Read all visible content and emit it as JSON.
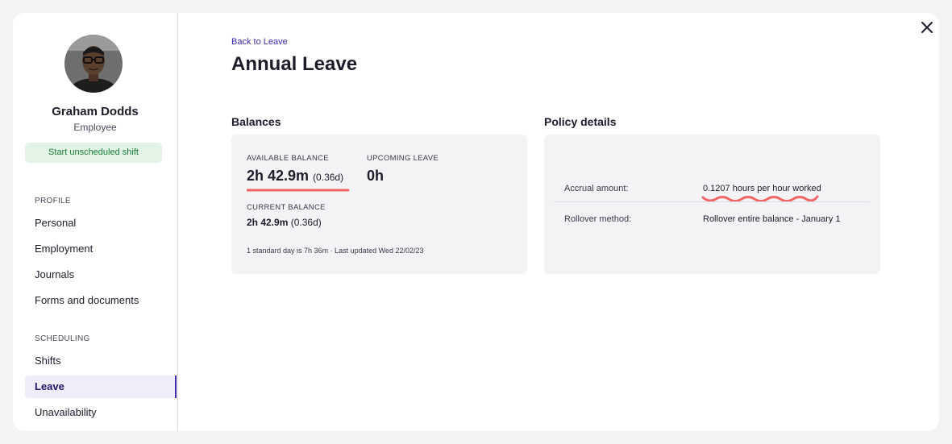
{
  "employee": {
    "name": "Graham Dodds",
    "role": "Employee"
  },
  "sidebar": {
    "shift_button": "Start unscheduled shift",
    "profile_label": "PROFILE",
    "profile_items": [
      "Personal",
      "Employment",
      "Journals",
      "Forms and documents"
    ],
    "scheduling_label": "SCHEDULING",
    "scheduling_items": [
      "Shifts",
      "Leave",
      "Unavailability"
    ],
    "active_item": "Leave"
  },
  "header": {
    "back_link": "Back to Leave",
    "title": "Annual Leave"
  },
  "balances": {
    "title": "Balances",
    "available_label": "AVAILABLE BALANCE",
    "available_value": "2h 42.9m",
    "available_days": "(0.36d)",
    "upcoming_label": "UPCOMING LEAVE",
    "upcoming_value": "0h",
    "current_label": "CURRENT BALANCE",
    "current_value": "2h 42.9m",
    "current_days": "(0.36d)",
    "footnote": "1 standard day is 7h 36m · Last updated Wed 22/02/23"
  },
  "policy": {
    "title": "Policy details",
    "rows": [
      {
        "label": "Accrual amount:",
        "value": "0.1207 hours per hour worked"
      },
      {
        "label": "Rollover method:",
        "value": "Rollover entire balance - January 1"
      }
    ]
  },
  "colors": {
    "accent": "#3a2bb0",
    "annotation": "#f06565",
    "success_bg": "#e3f4e6",
    "success_text": "#1a7a34"
  },
  "icons": {
    "close": "close-icon"
  }
}
